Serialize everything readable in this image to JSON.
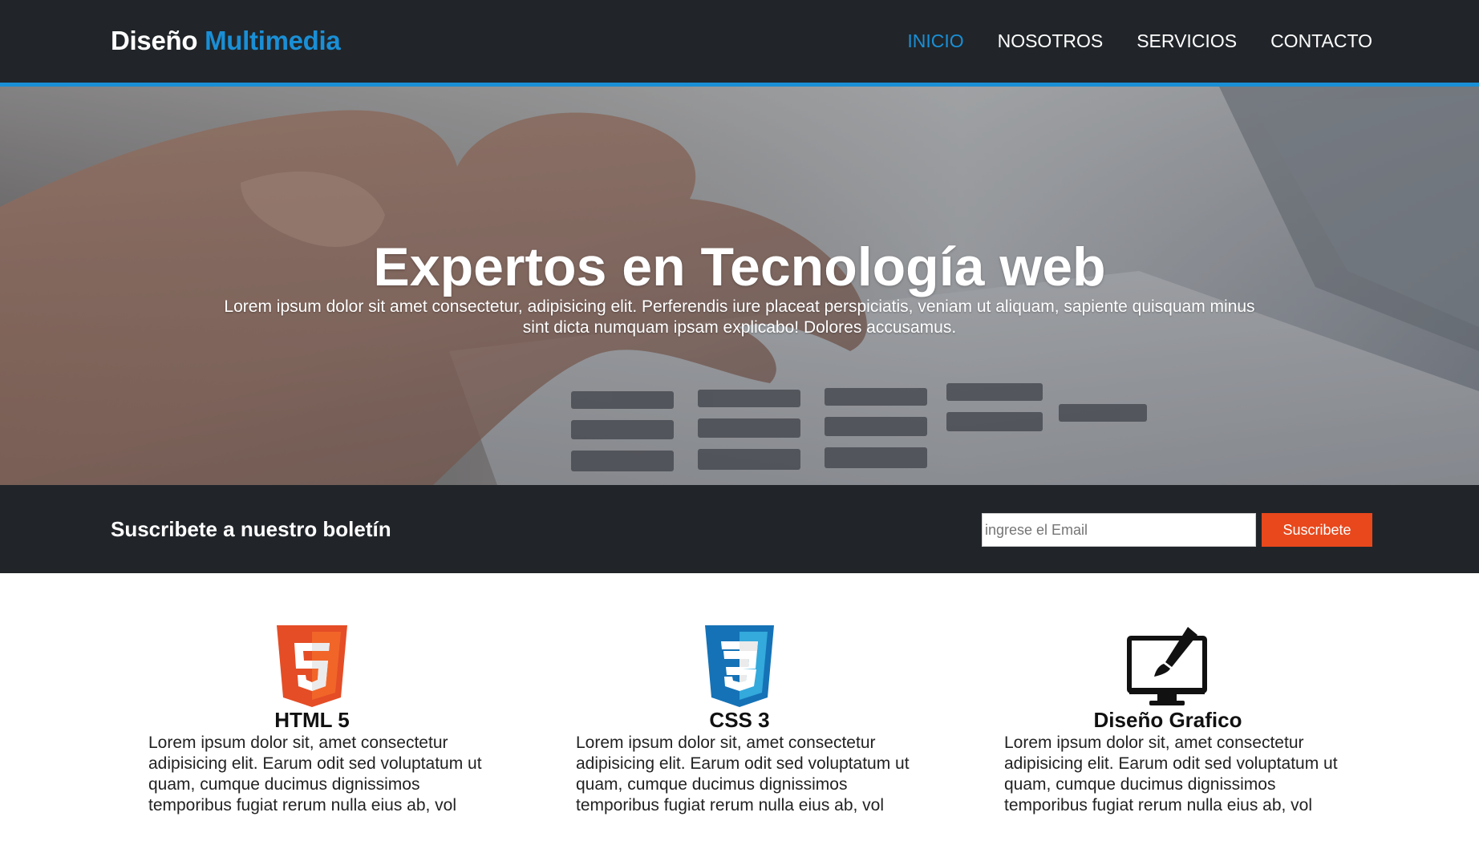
{
  "header": {
    "logo_main": "Diseño",
    "logo_accent": "Multimedia",
    "nav": [
      {
        "label": "INICIO",
        "active": true
      },
      {
        "label": "NOSOTROS",
        "active": false
      },
      {
        "label": "SERVICIOS",
        "active": false
      },
      {
        "label": "CONTACTO",
        "active": false
      }
    ]
  },
  "hero": {
    "title": "Expertos en Tecnología web",
    "text": "Lorem ipsum dolor sit amet consectetur, adipisicing elit. Perferendis iure placeat perspiciatis, veniam ut aliquam, sapiente quisquam minus sint dicta numquam ipsam explicabo! Dolores accusamus.",
    "background_image": "hands-typing-on-laptop-keyboard"
  },
  "newsletter": {
    "title": "Suscribete a nuestro boletín",
    "email_placeholder": "ingrese el Email",
    "button_label": "Suscribete"
  },
  "services": [
    {
      "icon": "html5-icon",
      "title": "HTML 5",
      "text": "Lorem ipsum dolor sit, amet consectetur adipisicing elit. Earum odit sed voluptatum ut quam, cumque ducimus dignissimos temporibus fugiat rerum nulla eius ab, vol"
    },
    {
      "icon": "css3-icon",
      "title": "CSS 3",
      "text": "Lorem ipsum dolor sit, amet consectetur adipisicing elit. Earum odit sed voluptatum ut quam, cumque ducimus dignissimos temporibus fugiat rerum nulla eius ab, vol"
    },
    {
      "icon": "graphic-design-monitor-icon",
      "title": "Diseño Grafico",
      "text": "Lorem ipsum dolor sit, amet consectetur adipisicing elit. Earum odit sed voluptatum ut quam, cumque ducimus dignissimos temporibus fugiat rerum nulla eius ab, vol"
    }
  ],
  "colors": {
    "header_bg": "#212529",
    "accent_blue": "#1a8fd6",
    "button_orange": "#e8481c",
    "html5_orange": "#e44d26",
    "css3_blue": "#1572b6"
  }
}
